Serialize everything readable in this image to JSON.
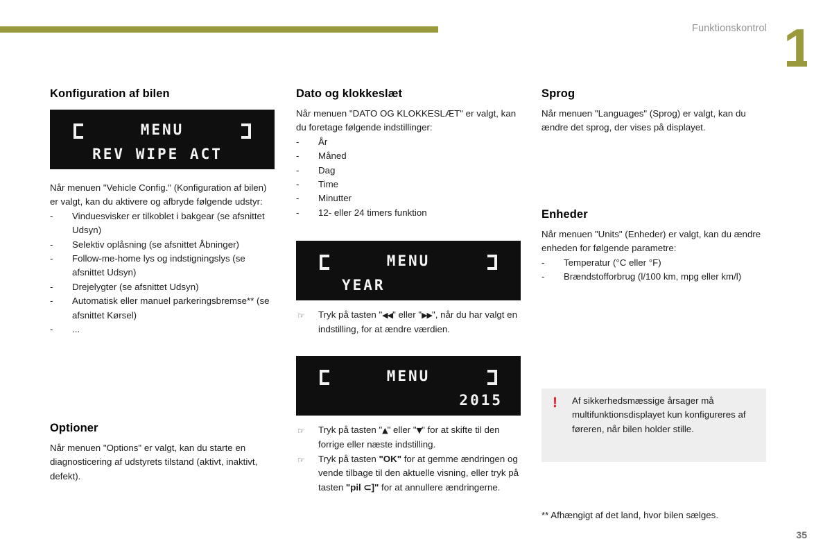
{
  "header": {
    "chapter_title": "Funktionskontrol",
    "chapter_number": "1",
    "accent_color": "#9a9a3c",
    "rule_color": "#9a9a3c"
  },
  "page": {
    "number": "35",
    "footnote": "** Afhængigt af det land, hvor bilen sælges."
  },
  "left_column": {
    "config": {
      "heading": "Konfiguration af bilen",
      "display": {
        "bracket_left": "[",
        "title": "MENU",
        "bracket_right": "]",
        "line2": "REV WIPE ACT"
      },
      "intro": "Når menuen \"Vehicle Config.\" (Konfiguration af bilen) er valgt, kan du aktivere og afbryde følgende udstyr:",
      "items": [
        "Vinduesvisker er tilkoblet i bakgear (se afsnittet Udsyn)",
        "Selektiv oplåsning (se afsnittet Åbninger)",
        "Follow-me-home lys og indstigningslys (se afsnittet Udsyn)",
        "Drejelygter (se afsnittet Udsyn)",
        "Automatisk eller manuel parkeringsbremse** (se afsnittet Kørsel)",
        "..."
      ]
    },
    "options": {
      "heading": "Optioner",
      "body": "Når menuen \"Options\" er valgt, kan du starte en diagnosticering af udstyrets tilstand (aktivt, inaktivt, defekt)."
    }
  },
  "middle_column": {
    "datetime": {
      "heading": "Dato og klokkeslæt",
      "intro": "Når menuen \"DATO OG KLOKKESLÆT\" er valgt, kan du foretage følgende indstillinger:",
      "items": [
        "År",
        "Måned",
        "Dag",
        "Time",
        "Minutter",
        "12- eller 24 timers funktion"
      ],
      "display_year": {
        "bracket_left": "[",
        "title": "MENU",
        "bracket_right": "]",
        "line2": "YEAR"
      },
      "instruction_1_pre": "Tryk på tasten \"",
      "instruction_1_key_a": "◀◀",
      "instruction_1_mid": "\" eller \"",
      "instruction_1_key_b": "▶▶",
      "instruction_1_post": "\", når du har valgt en indstilling, for at ændre værdien.",
      "display_value": {
        "bracket_left": "[",
        "title": "MENU",
        "bracket_right": "]",
        "line2": "2015"
      },
      "instruction_2_pre": "Tryk på tasten \"",
      "instruction_2_key_a": "▲",
      "instruction_2_mid": "\" eller \"",
      "instruction_2_key_b": "▼",
      "instruction_2_post": "\" for at skifte til den forrige eller næste indstilling.",
      "instruction_3_pre": "Tryk på tasten ",
      "instruction_3_ok": "\"OK\"",
      "instruction_3_mid": " for at gemme ændringen og vende tilbage til den aktuelle visning, eller tryk på tasten ",
      "instruction_3_arrow": "\"pil ⊂]\"",
      "instruction_3_post": " for at annullere ændringerne."
    }
  },
  "right_column": {
    "language": {
      "heading": "Sprog",
      "body": "Når menuen \"Languages\" (Sprog) er valgt, kan du ændre det sprog, der vises på displayet."
    },
    "units": {
      "heading": "Enheder",
      "intro": "Når menuen \"Units\" (Enheder) er valgt, kan du ændre enheden for følgende parametre:",
      "items": [
        "Temperatur (°C eller °F)",
        "Brændstofforbrug (l/100 km, mpg eller km/l)"
      ]
    },
    "warning": {
      "icon": "!",
      "icon_color": "#e3202a",
      "background": "#eeeeee",
      "text": "Af sikkerhedsmæssige årsager må multifunktionsdisplayet kun konfigureres af føreren, når bilen holder stille."
    }
  }
}
